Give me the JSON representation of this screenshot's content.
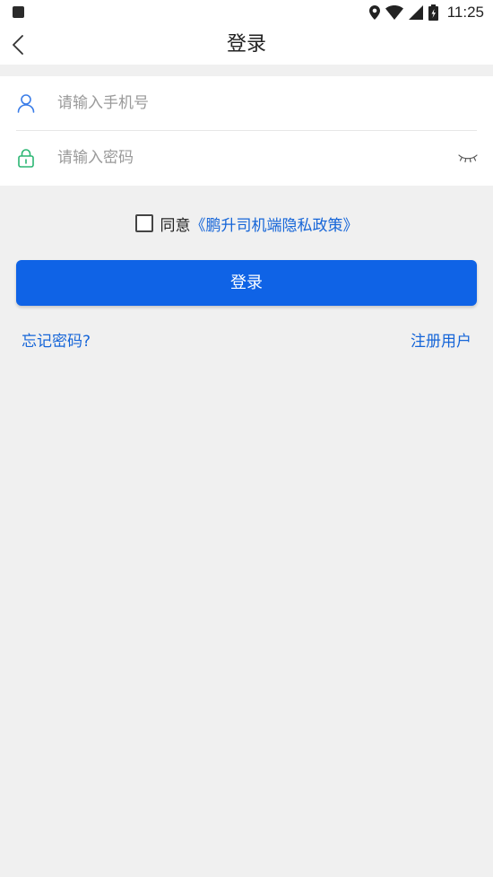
{
  "status_bar": {
    "time": "11:25",
    "icons": [
      "notification-square-icon",
      "location-pin-icon",
      "wifi-icon",
      "cell-signal-icon",
      "battery-icon"
    ]
  },
  "header": {
    "title": "登录",
    "back_icon": "chevron-left-icon"
  },
  "form": {
    "phone": {
      "placeholder": "请输入手机号",
      "value": "",
      "icon": "user-icon",
      "icon_color": "#3a7de8"
    },
    "password": {
      "placeholder": "请输入密码",
      "value": "",
      "icon": "lock-icon",
      "icon_color": "#2bb673",
      "toggle_icon": "eye-closed-icon"
    }
  },
  "agreement": {
    "checked": false,
    "prefix": "同意",
    "policy_link": "《鹏升司机端隐私政策》"
  },
  "login_button": {
    "label": "登录"
  },
  "links": {
    "forgot_password": "忘记密码?",
    "register": "注册用户"
  },
  "colors": {
    "primary": "#0f63e6",
    "link": "#1565d8",
    "background": "#f0f0f0"
  }
}
